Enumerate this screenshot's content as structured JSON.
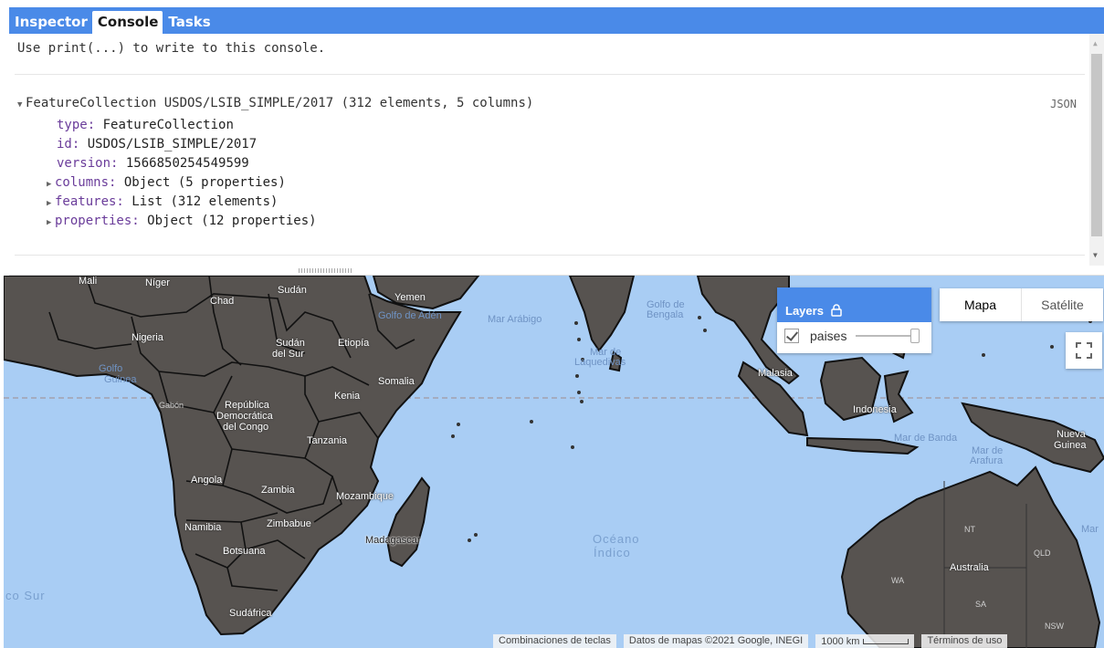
{
  "tabs": [
    {
      "label": "Inspector"
    },
    {
      "label": "Console"
    },
    {
      "label": "Tasks"
    }
  ],
  "console": {
    "hint": "Use print(...) to write to this console.",
    "feature_collection": {
      "header": "FeatureCollection USDOS/LSIB_SIMPLE/2017 (312 elements, 5 columns)",
      "json_label": "JSON",
      "fields": [
        {
          "key": "type:",
          "value": "FeatureCollection"
        },
        {
          "key": "id:",
          "value": "USDOS/LSIB_SIMPLE/2017"
        },
        {
          "key": "version:",
          "value": "1566850254549599"
        }
      ],
      "expandables": [
        {
          "key": "columns:",
          "value": "Object (5 properties)"
        },
        {
          "key": "features:",
          "value": "List (312 elements)"
        },
        {
          "key": "properties:",
          "value": "Object (12 properties)"
        }
      ]
    }
  },
  "map": {
    "layers_panel": {
      "title": "Layers",
      "layer_name": "paises"
    },
    "map_type": {
      "map": "Mapa",
      "satellite": "Satélite"
    },
    "labels": {
      "mali": "Mali",
      "niger": "Níger",
      "chad": "Chad",
      "sudan": "Sudán",
      "yemen": "Yemen",
      "nigeria": "Nigeria",
      "sudan_sur_1": "Sudán",
      "sudan_sur_2": "del Sur",
      "etiopia": "Etiopía",
      "somalia": "Somalia",
      "kenia": "Kenia",
      "gabon": "Gabón",
      "rdc_1": "República",
      "rdc_2": "Democrática",
      "rdc_3": "del Congo",
      "tanzania": "Tanzania",
      "angola": "Angola",
      "zambia": "Zambia",
      "mozambique": "Mozambique",
      "namibia": "Namibia",
      "zimbabue": "Zimbabue",
      "botsuana": "Botsuana",
      "sudafrica": "Sudáfrica",
      "madagascar": "Madagascar",
      "malasia": "Malasia",
      "indonesia": "Indonesia",
      "nueva_guinea_1": "Nueva",
      "nueva_guinea_2": "Guinea",
      "australia": "Australia",
      "nt": "NT",
      "wa": "WA",
      "qld": "QLD",
      "sa": "SA",
      "nsw": "NSW",
      "golfo_guinea_1": "Golfo",
      "golfo_guinea_2": "Guinea",
      "golfo_aden": "Golfo de Adén",
      "mar_arabigo": "Mar Arábigo",
      "golfo_bengala_1": "Golfo de",
      "golfo_bengala_2": "Bengala",
      "mar_laquedivas_1": "Mar de",
      "mar_laquedivas_2": "Laquedivas",
      "mar_banda": "Mar de Banda",
      "mar_arafura_1": "Mar de",
      "mar_arafura_2": "Arafura",
      "oceano_1": "Océano",
      "oceano_2": "Índico",
      "co_sur": "co Sur",
      "mar_right": "Mar"
    },
    "attribution": {
      "shortcuts": "Combinaciones de teclas",
      "data": "Datos de mapas ©2021 Google, INEGI",
      "scale": "1000 km",
      "terms": "Términos de uso"
    }
  }
}
